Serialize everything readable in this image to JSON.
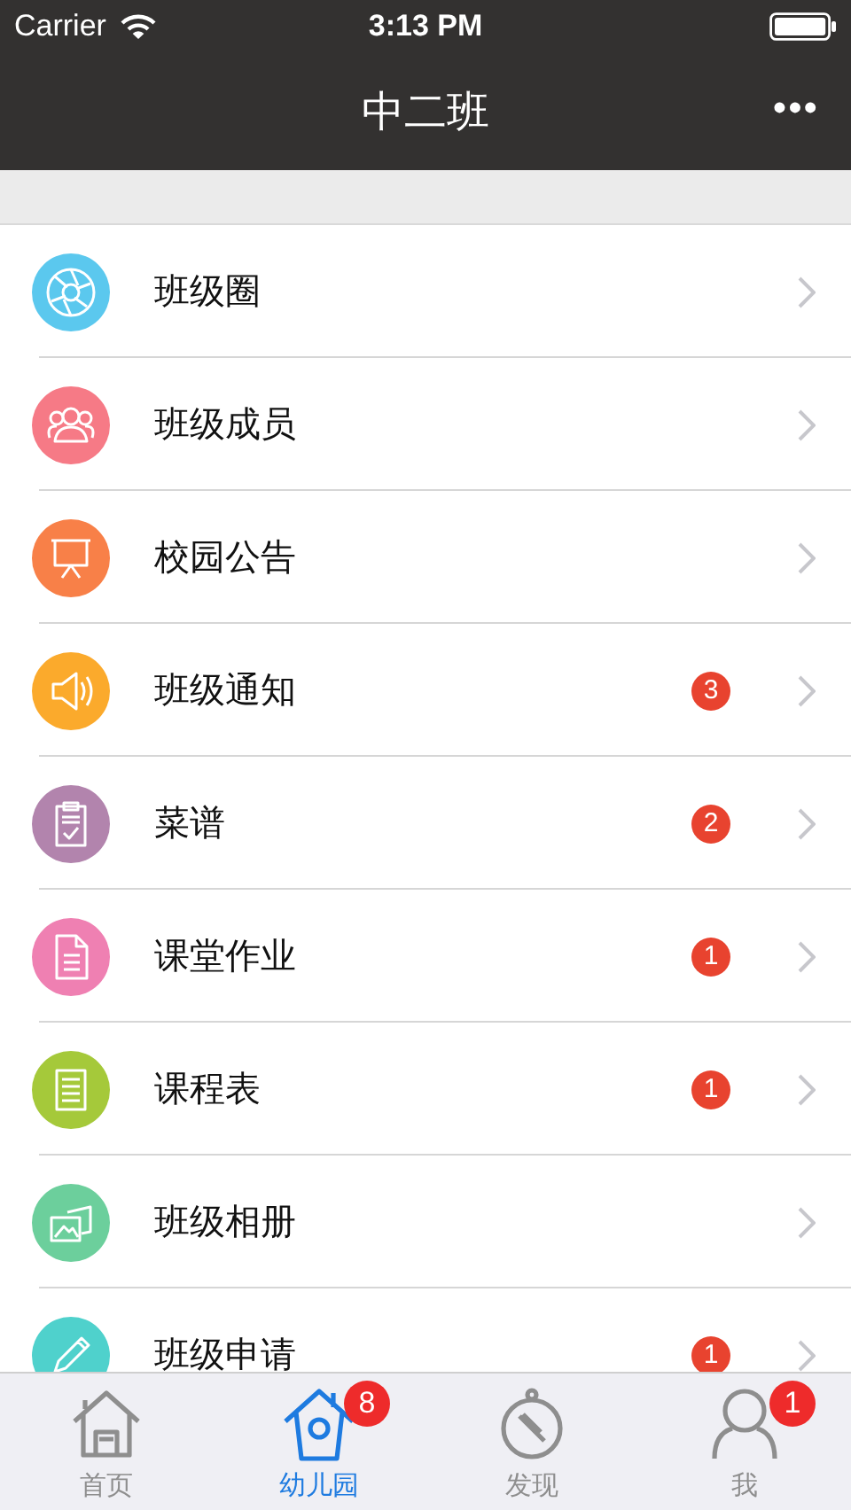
{
  "status_bar": {
    "carrier": "Carrier",
    "time": "3:13 PM"
  },
  "nav": {
    "title": "中二班",
    "more": "•••"
  },
  "items": [
    {
      "label": "班级圈",
      "color": "#5bc8ee"
    },
    {
      "label": "班级成员",
      "color": "#f67a86"
    },
    {
      "label": "校园公告",
      "color": "#f88048"
    },
    {
      "label": "班级通知",
      "color": "#fbaa2c",
      "badge": "3"
    },
    {
      "label": "菜谱",
      "color": "#b284ad",
      "badge": "2"
    },
    {
      "label": "课堂作业",
      "color": "#ef80b2",
      "badge": "1"
    },
    {
      "label": "课程表",
      "color": "#a5c93a",
      "badge": "1"
    },
    {
      "label": "班级相册",
      "color": "#6ccf9c"
    },
    {
      "label": "班级申请",
      "color": "#4fd1cc",
      "badge": "1"
    }
  ],
  "tabs": [
    {
      "label": "首页",
      "selected": false
    },
    {
      "label": "幼儿园",
      "selected": true,
      "badge": "8"
    },
    {
      "label": "发现",
      "selected": false
    },
    {
      "label": "我",
      "selected": false,
      "badge": "1"
    }
  ]
}
